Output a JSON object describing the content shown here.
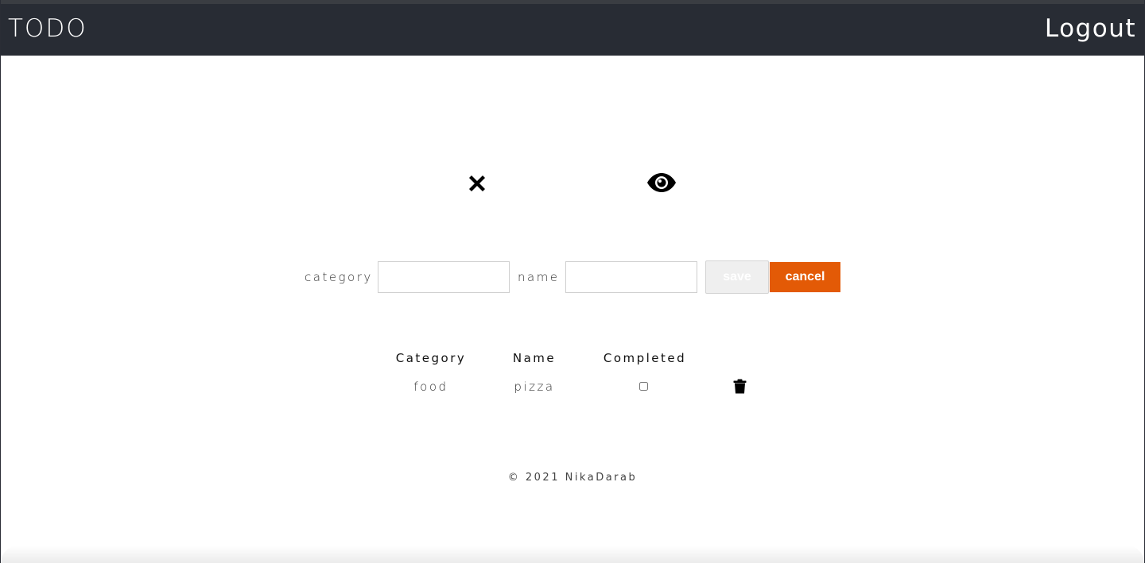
{
  "header": {
    "brand": "TODO",
    "logout_label": "Logout"
  },
  "toolbar": {
    "close_icon": "close-icon",
    "eye_icon": "eye-icon"
  },
  "form": {
    "category_label": "category",
    "category_value": "",
    "name_label": "name",
    "name_value": "",
    "save_label": "save",
    "cancel_label": "cancel"
  },
  "table": {
    "headers": [
      "Category",
      "Name",
      "Completed"
    ],
    "rows": [
      {
        "category": "food",
        "name": "pizza",
        "completed": false
      }
    ],
    "delete_icon": "trash-icon"
  },
  "footer": {
    "text": "© 2021 NikaDarab"
  },
  "colors": {
    "topbar": "#282c34",
    "cancel": "#e35a06",
    "save_disabled": "#efefef"
  }
}
